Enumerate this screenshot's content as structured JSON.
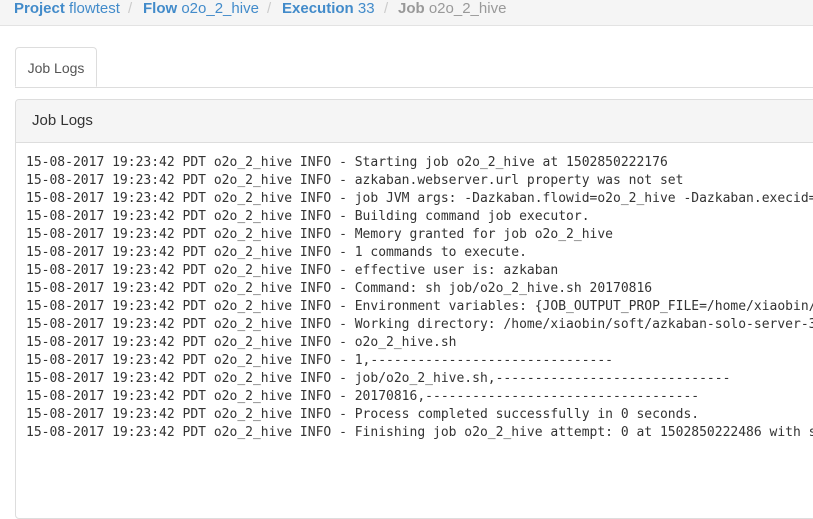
{
  "breadcrumb": {
    "project": {
      "key": "Project",
      "value": "flowtest"
    },
    "flow": {
      "key": "Flow",
      "value": "o2o_2_hive"
    },
    "execution": {
      "key": "Execution",
      "value": "33"
    },
    "job": {
      "key": "Job",
      "value": "o2o_2_hive"
    },
    "separator": "/"
  },
  "tabs": [
    {
      "label": "Job Logs"
    }
  ],
  "panel": {
    "title": "Job Logs"
  },
  "log_lines": [
    "15-08-2017 19:23:42 PDT o2o_2_hive INFO - Starting job o2o_2_hive at 1502850222176",
    "15-08-2017 19:23:42 PDT o2o_2_hive INFO - azkaban.webserver.url property was not set",
    "15-08-2017 19:23:42 PDT o2o_2_hive INFO - job JVM args: -Dazkaban.flowid=o2o_2_hive -Dazkaban.execid=",
    "15-08-2017 19:23:42 PDT o2o_2_hive INFO - Building command job executor.",
    "15-08-2017 19:23:42 PDT o2o_2_hive INFO - Memory granted for job o2o_2_hive",
    "15-08-2017 19:23:42 PDT o2o_2_hive INFO - 1 commands to execute.",
    "15-08-2017 19:23:42 PDT o2o_2_hive INFO - effective user is: azkaban",
    "15-08-2017 19:23:42 PDT o2o_2_hive INFO - Command: sh job/o2o_2_hive.sh 20170816",
    "15-08-2017 19:23:42 PDT o2o_2_hive INFO - Environment variables: {JOB_OUTPUT_PROP_FILE=/home/xiaobin/",
    "15-08-2017 19:23:42 PDT o2o_2_hive INFO - Working directory: /home/xiaobin/soft/azkaban-solo-server-3",
    "15-08-2017 19:23:42 PDT o2o_2_hive INFO - o2o_2_hive.sh",
    "15-08-2017 19:23:42 PDT o2o_2_hive INFO - 1,-------------------------------",
    "15-08-2017 19:23:42 PDT o2o_2_hive INFO - job/o2o_2_hive.sh,------------------------------",
    "15-08-2017 19:23:42 PDT o2o_2_hive INFO - 20170816,-----------------------------------",
    "15-08-2017 19:23:42 PDT o2o_2_hive INFO - Process completed successfully in 0 seconds.",
    "15-08-2017 19:23:42 PDT o2o_2_hive INFO - Finishing job o2o_2_hive attempt: 0 at 1502850222486 with s"
  ]
}
